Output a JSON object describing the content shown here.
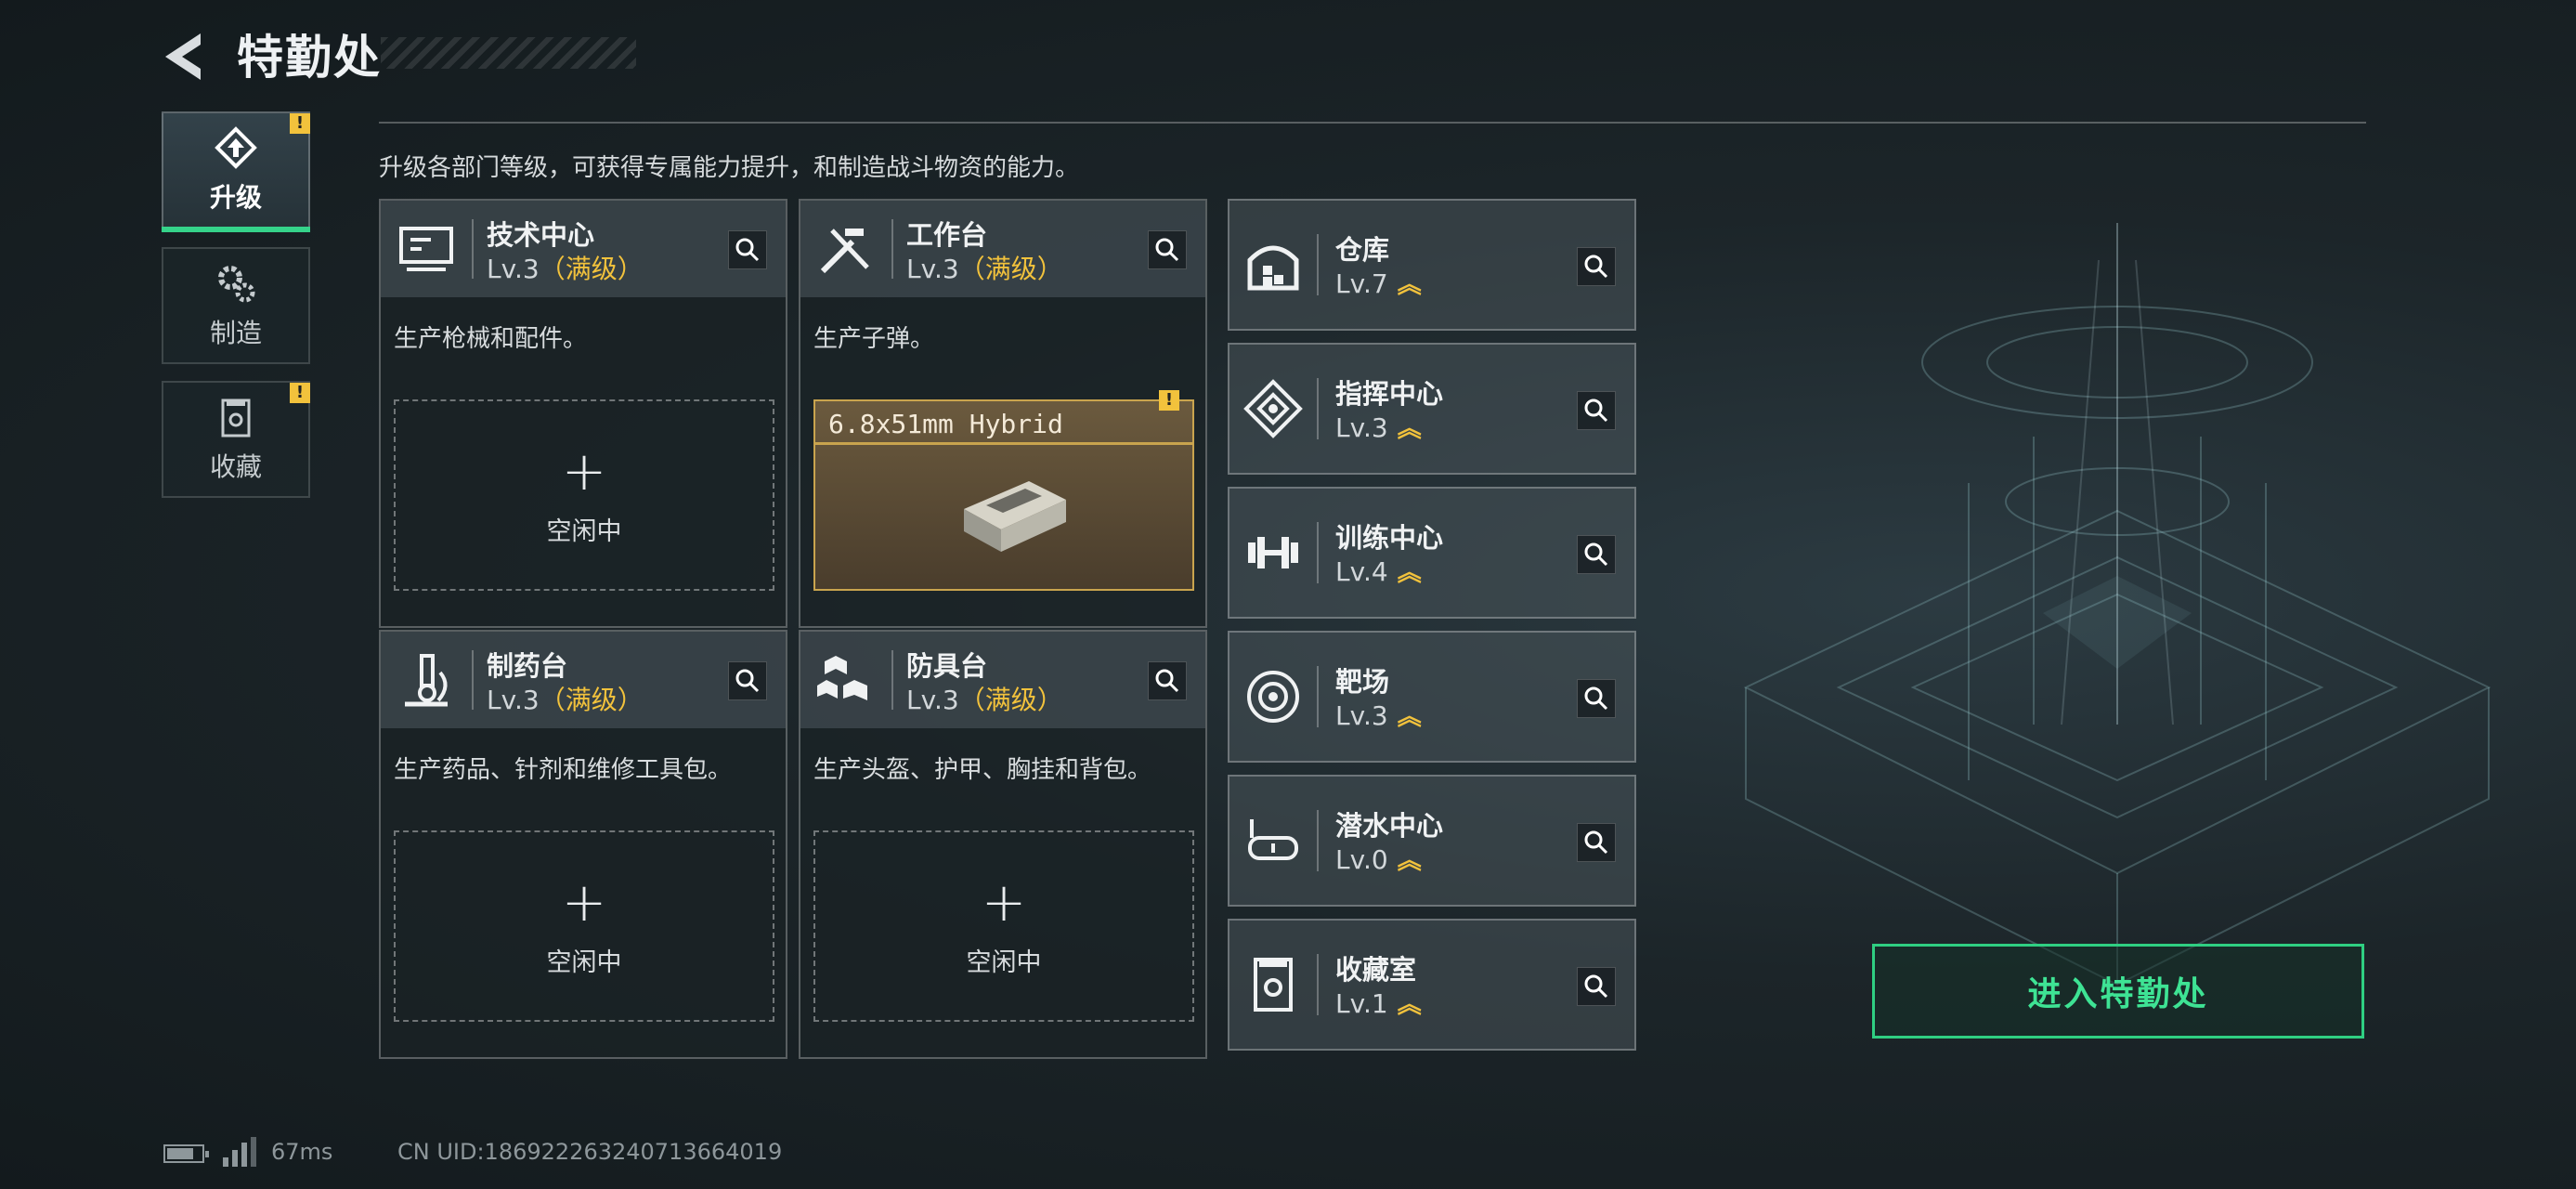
{
  "header": {
    "title": "特勤处"
  },
  "tabs": [
    {
      "label": "升级",
      "icon": "upgrade-icon",
      "active": true,
      "alert": "!"
    },
    {
      "label": "制造",
      "icon": "gears-icon",
      "active": false,
      "alert": ""
    },
    {
      "label": "收藏",
      "icon": "collection-icon",
      "active": false,
      "alert": "!"
    }
  ],
  "description": "升级各部门等级，可获得专属能力提升，和制造战斗物资的能力。",
  "stations": [
    {
      "name": "技术中心",
      "level": "Lv.3",
      "max": "（满级）",
      "desc": "生产枪械和配件。",
      "icon": "computer-icon",
      "slot_label": "空闲中"
    },
    {
      "name": "工作台",
      "level": "Lv.3",
      "max": "（满级）",
      "desc": "生产子弹。",
      "icon": "tools-icon",
      "slot_item": {
        "name": "6.8x51mm Hybrid",
        "icon": "ammo-box-icon",
        "alert": "!"
      }
    },
    {
      "name": "制药台",
      "level": "Lv.3",
      "max": "（满级）",
      "desc": "生产药品、针剂和维修工具包。",
      "icon": "microscope-icon",
      "slot_label": "空闲中"
    },
    {
      "name": "防具台",
      "level": "Lv.3",
      "max": "（满级）",
      "desc": "生产头盔、护甲、胸挂和背包。",
      "icon": "armor-boxes-icon",
      "slot_label": "空闲中"
    }
  ],
  "facilities": [
    {
      "name": "仓库",
      "level": "Lv.7",
      "icon": "warehouse-icon"
    },
    {
      "name": "指挥中心",
      "level": "Lv.3",
      "icon": "command-icon"
    },
    {
      "name": "训练中心",
      "level": "Lv.4",
      "icon": "dumbbell-icon"
    },
    {
      "name": "靶场",
      "level": "Lv.3",
      "icon": "target-icon"
    },
    {
      "name": "潜水中心",
      "level": "Lv.0",
      "icon": "dive-mask-icon"
    },
    {
      "name": "收藏室",
      "level": "Lv.1",
      "icon": "collection-room-icon"
    }
  ],
  "upgrade_chevron": "︽",
  "enter_button": "进入特勤处",
  "status_bar": {
    "ping": "67ms",
    "uid": "CN UID:18692226324071366401​9"
  },
  "colors": {
    "accent": "#35d38a",
    "max_level": "#f2c23c",
    "alert": "#f2c23c"
  }
}
